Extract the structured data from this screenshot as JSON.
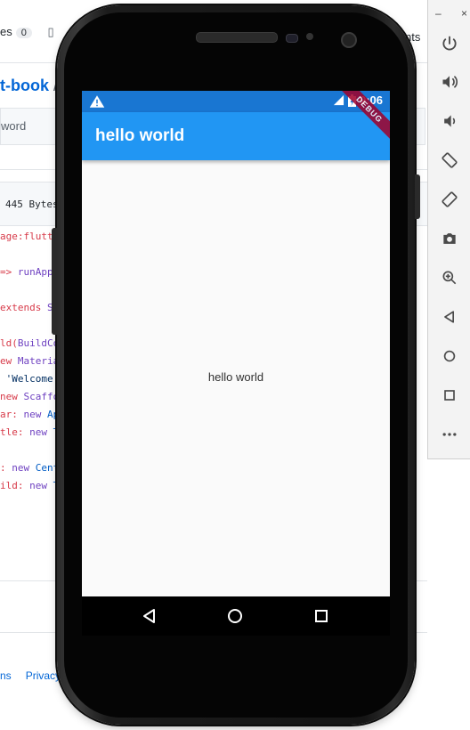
{
  "background_page": {
    "tab_issues_text": "es",
    "tab_issues_count": "0",
    "tab_right_text": "nts",
    "repo_name": "t-book",
    "repo_sep": "/",
    "search_placeholder": "word",
    "file_size": "445 Bytes",
    "code_lines": [
      [
        "age:flutte",
        "",
        ""
      ],
      [
        "",
        "",
        ""
      ],
      [
        "=> ",
        "runApp",
        ""
      ],
      [
        "",
        "",
        ""
      ],
      [
        "extends ",
        "St",
        ""
      ],
      [
        "",
        "",
        ""
      ],
      [
        "ld(",
        "BuildCo",
        ""
      ],
      [
        "ew ",
        "Materia",
        ""
      ],
      [
        " 'Welcome",
        "",
        ""
      ],
      [
        "new ",
        "Scaffo",
        ""
      ],
      [
        "ar: ",
        "new ",
        "Ap"
      ],
      [
        "tle: ",
        "new ",
        "T"
      ],
      [
        "",
        "",
        ""
      ],
      [
        ": ",
        "new ",
        "Cent"
      ],
      [
        "ild: ",
        "new ",
        "T"
      ]
    ],
    "footer_links": [
      "ns",
      "Privacy"
    ]
  },
  "toolbar": {
    "minimize": "–",
    "close": "×",
    "buttons": [
      "power-icon",
      "volume-up-icon",
      "volume-down-icon",
      "rotate-left-icon",
      "rotate-right-icon",
      "camera-icon",
      "zoom-icon",
      "back-icon",
      "home-icon",
      "overview-icon",
      "more-icon"
    ]
  },
  "status_bar": {
    "time": "9:06"
  },
  "app": {
    "title": "hello world",
    "body_text": "hello world",
    "debug_banner": "DEBUG",
    "appbar_color": "#2196f3",
    "statusbar_color": "#1976d2"
  }
}
